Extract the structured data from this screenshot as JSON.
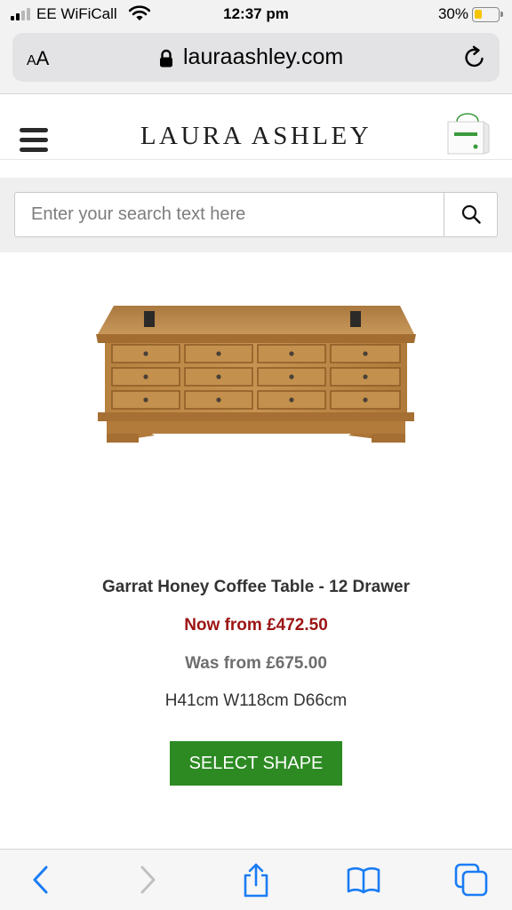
{
  "status_bar": {
    "carrier": "EE WiFiCall",
    "time": "12:37 pm",
    "battery_percent": "30%",
    "battery_level": 0.3,
    "signal_bars": 2,
    "battery_color": "#f5c400"
  },
  "browser": {
    "text_size_label": "AA",
    "url": "lauraashley.com",
    "icons": [
      "lock-icon",
      "reload-icon"
    ]
  },
  "header": {
    "logo_text": "LAURA ASHLEY",
    "icons": [
      "hamburger-menu-icon",
      "shopping-bag-icon"
    ]
  },
  "search": {
    "placeholder": "Enter your search text here",
    "value": "",
    "icon": "search-icon"
  },
  "product": {
    "title": "Garrat Honey Coffee Table - 12 Drawer",
    "price_now": "Now from £472.50",
    "price_was": "Was from £675.00",
    "dimensions": "H41cm W118cm D66cm",
    "cta_label": "SELECT SHAPE",
    "colors": {
      "now_price": "#9c1414",
      "was_price": "#6e6e6e",
      "cta_background": "#2d8a23"
    }
  },
  "toolbar": {
    "icons": [
      "back-icon",
      "forward-icon",
      "share-icon",
      "bookmarks-icon",
      "tabs-icon"
    ],
    "accent_color": "#1a7cf5"
  }
}
